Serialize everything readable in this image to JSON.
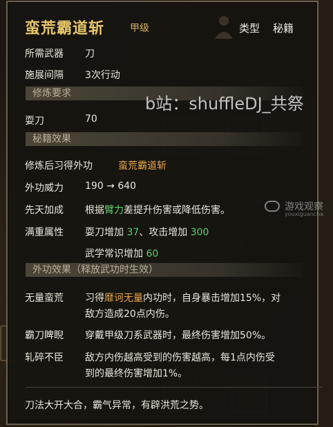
{
  "skill": {
    "name": "蛮荒霸道斩",
    "grade": "甲级",
    "type_label": "类型",
    "type_value": "秘籍"
  },
  "info": {
    "weapon_label": "所需武器",
    "weapon_value": "刀",
    "interval_label": "施展间隔",
    "interval_value": "3次行动"
  },
  "requirements": {
    "header": "修炼要求",
    "label": "耍刀",
    "value": "70"
  },
  "effects": {
    "header": "秘籍效果",
    "learn_label": "修炼后习得外功",
    "learn_value": "蛮荒霸道斩",
    "power_label": "外功威力",
    "power_value": "190 → 640",
    "innate_label": "先天加成",
    "innate_pre": "根据",
    "innate_attr": "臂力",
    "innate_post": "差提升伤害或降低伤害。",
    "full_label": "满重属性",
    "full_a_pre": "耍刀增加",
    "full_a_val": "37",
    "full_sep": "、攻击增加",
    "full_b_val": "300",
    "full_c_pre": "武学常识增加",
    "full_c_val": "60"
  },
  "outer": {
    "header": "外功效果（释放武功时生效）",
    "e1_label": "无量蛮荒",
    "e1_pre": "习得",
    "e1_hl": "靡诃无量",
    "e1_post": "内功时，自身暴击增加15%，对",
    "e1_line2": "敌方造成20点内伤。",
    "e2_label": "霸刀睥睨",
    "e2_text": "穿戴甲级刀系武器时，最终伤害增加50%。",
    "e3_label": "轧碎不臣",
    "e3_line1": "敌方内伤越高受到的伤害越高，每1点内伤受",
    "e3_line2": "到的最终伤害增加1%。"
  },
  "flavor": "刀法大开大合，霸气异常，有辟洪荒之势。",
  "watermark": "b站：shuffleDJ_共祭",
  "watermark2": "游戏观察",
  "watermark2_sub": "youxiguancha",
  "colors": {
    "title": "#e7c56a",
    "highlight_orange": "#e9a64a",
    "highlight_green": "#5cd06a"
  }
}
